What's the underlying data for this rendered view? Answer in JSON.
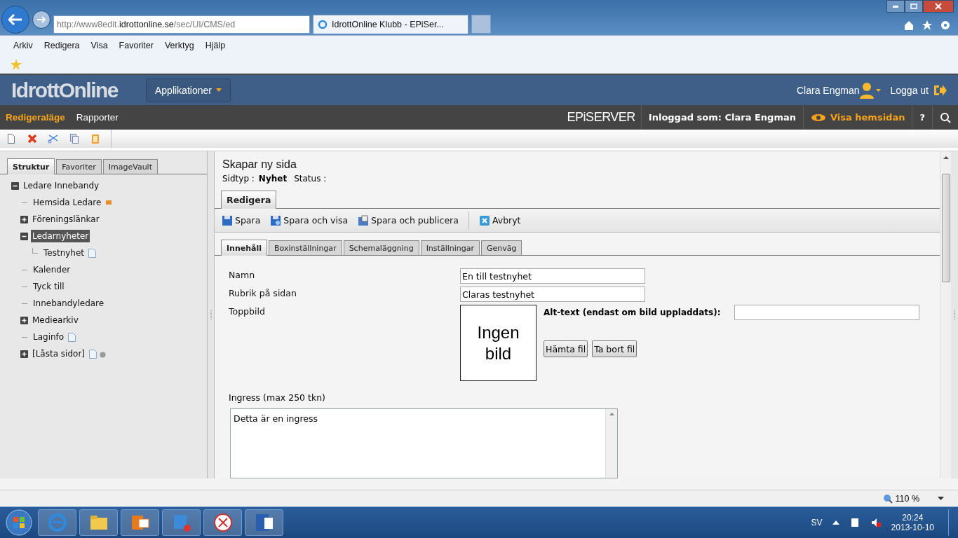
{
  "browser": {
    "address": {
      "prefix": "http://www8edit.",
      "domain": "idrottonline.se",
      "path": "/sec/UI/CMS/ed"
    },
    "tab": {
      "title": "IdrottOnline Klubb - EPiSer...",
      "selected": true
    },
    "menu": [
      "Arkiv",
      "Redigera",
      "Visa",
      "Favoriter",
      "Verktyg",
      "Hjälp"
    ],
    "zoom": "110 %"
  },
  "header": {
    "logo": "IdrottOnline",
    "apps_button": "Applikationer",
    "user": "Clara Engman",
    "logout": "Logga ut"
  },
  "nav": {
    "items": [
      {
        "label": "Redigeraläge",
        "selected": true
      },
      {
        "label": "Rapporter",
        "selected": false
      }
    ],
    "brand": "EPiSERVER",
    "logged_in": "Inloggad som: Clara Engman",
    "view_site": "Visa hemsidan",
    "help": "?"
  },
  "sidebar": {
    "tabs": [
      {
        "label": "Struktur",
        "selected": true
      },
      {
        "label": "Favoriter",
        "selected": false
      },
      {
        "label": "ImageVault",
        "selected": false
      }
    ],
    "tree": [
      {
        "label": "Ledare Innebandy",
        "kind": "branch",
        "expanded": true,
        "selected": false,
        "children": [
          {
            "label": "Hemsida Ledare",
            "kind": "leaf",
            "selected": false,
            "shortcut": true
          },
          {
            "label": "Föreningslänkar",
            "kind": "branch",
            "expanded": false,
            "selected": false
          },
          {
            "label": "Ledarnyheter",
            "kind": "branch",
            "expanded": true,
            "selected": true,
            "children": [
              {
                "label": "Testnyhet",
                "kind": "leaf",
                "selected": false,
                "page_file": true
              }
            ]
          },
          {
            "label": "Kalender",
            "kind": "leaf",
            "selected": false
          },
          {
            "label": "Tyck till",
            "kind": "leaf",
            "selected": false
          },
          {
            "label": "Innebandyledare",
            "kind": "leaf",
            "selected": false
          },
          {
            "label": "Mediearkiv",
            "kind": "branch",
            "expanded": false,
            "selected": false
          },
          {
            "label": "Laginfo",
            "kind": "leaf",
            "selected": false,
            "page_file": true
          },
          {
            "label": "[Låsta sidor]",
            "kind": "branch",
            "expanded": false,
            "selected": false,
            "page_file": true,
            "locked": true
          }
        ]
      }
    ]
  },
  "editor": {
    "title": "Skapar ny sida",
    "page_type_label": "Sidtyp :",
    "page_type": "Nyhet",
    "status_label": "Status :",
    "mode_tabs": [
      {
        "label": "Redigera",
        "selected": true
      }
    ],
    "actions": [
      {
        "label": "Spara",
        "kind": "save"
      },
      {
        "label": "Spara och visa",
        "kind": "save-view"
      },
      {
        "label": "Spara och publicera",
        "kind": "publish"
      },
      {
        "label": "Avbryt",
        "kind": "cancel"
      }
    ],
    "tabs": [
      {
        "label": "Innehåll",
        "selected": true
      },
      {
        "label": "Boxinställningar",
        "selected": false
      },
      {
        "label": "Schemaläggning",
        "selected": false
      },
      {
        "label": "Inställningar",
        "selected": false
      },
      {
        "label": "Genväg",
        "selected": false
      }
    ],
    "fields": [
      {
        "label": "Namn",
        "value": "En till testnyhet"
      },
      {
        "label": "Rubrik på sidan",
        "value": "Claras testnyhet"
      }
    ],
    "image": {
      "label": "Toppbild",
      "placeholder_text": "Ingen bild",
      "alt_label": "Alt-text (endast om bild uppladdats):",
      "buttons": [
        "Hämta fil",
        "Ta bort fil"
      ]
    },
    "ingress": {
      "label": "Ingress (max 250 tkn)",
      "value": "Detta är en ingress"
    }
  },
  "taskbar": {
    "language": "SV",
    "time": "20:24",
    "date": "2013-10-10"
  }
}
